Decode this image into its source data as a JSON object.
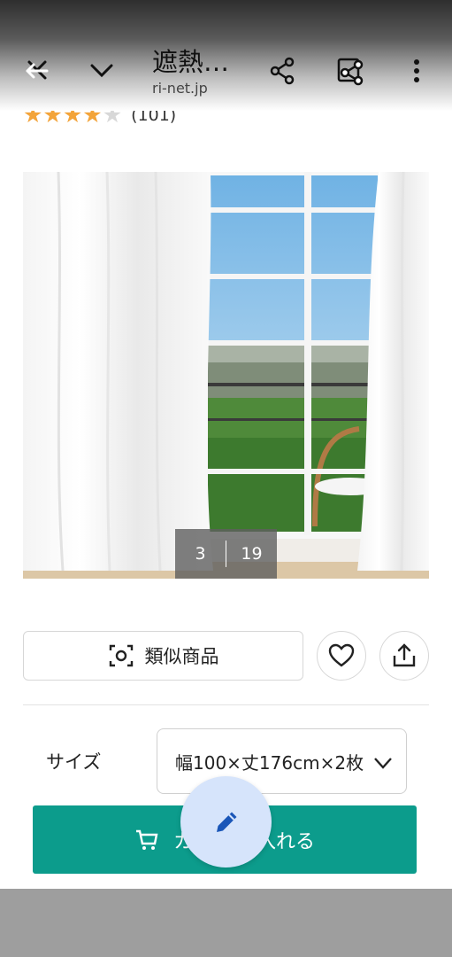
{
  "browser": {
    "title": "遮熱…",
    "url": "ri-net.jp",
    "icons": [
      "back-close-icon",
      "chevron-down-icon",
      "share-icon",
      "share-page-icon",
      "more-vert-icon"
    ]
  },
  "product": {
    "rating_stars": 4,
    "rating_max": 5,
    "review_count": "(101)",
    "image_counter": {
      "current": "3",
      "total": "19"
    }
  },
  "actions": {
    "similar_label": "類似商品",
    "favorite_icon": "heart-icon",
    "share_icon": "upload-share-icon"
  },
  "options": {
    "size_label": "サイズ",
    "size_value": "幅100×丈176cm×2枚"
  },
  "cart": {
    "label_left": "カ",
    "label_right": "入れる"
  },
  "colors": {
    "cart_button": "#0c9c8c",
    "star": "#f3a43a",
    "fab_bg": "#d6e4fb",
    "fab_icon": "#1a56b8"
  }
}
